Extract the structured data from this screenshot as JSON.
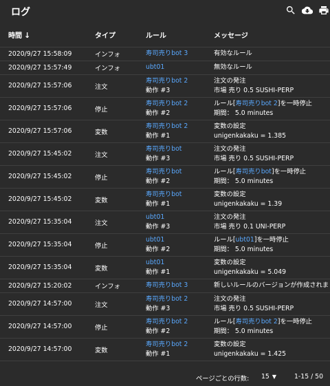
{
  "header": {
    "title": "ログ",
    "icons": [
      "search-icon",
      "download-icon",
      "print-icon"
    ]
  },
  "table": {
    "headers": {
      "time": "時間",
      "sort_arrow": "↓",
      "type": "タイプ",
      "rule": "ルール",
      "message": "メッセージ"
    },
    "rows": [
      {
        "time": "2020/9/27 15:58:09",
        "type": "インフォ",
        "rule": "寿司売りbot 3",
        "action": "",
        "msg1": "有効なルール",
        "msg2": ""
      },
      {
        "time": "2020/9/27 15:57:49",
        "type": "インフォ",
        "rule": "ubt01",
        "action": "",
        "msg1": "無効なルール",
        "msg2": ""
      },
      {
        "time": "2020/9/27 15:57:06",
        "type": "注文",
        "rule": "寿司売りbot 2",
        "action": "動作 #3",
        "msg1": "注文の発注",
        "msg2": "市場 売り 0.5 SUSHI-PERP"
      },
      {
        "time": "2020/9/27 15:57:06",
        "type": "停止",
        "rule": "寿司売りbot 2",
        "action": "動作 #2",
        "msg1_pre": "ルール[",
        "msg1_link": "寿司売りbot 2",
        "msg1_post": "]を一時停止",
        "msg2": "期間： 5.0 minutes"
      },
      {
        "time": "2020/9/27 15:57:06",
        "type": "変数",
        "rule": "寿司売りbot 2",
        "action": "動作 #1",
        "msg1": "変数の設定",
        "msg2": "unigenkakaku = 1.385"
      },
      {
        "time": "2020/9/27 15:45:02",
        "type": "注文",
        "rule": "寿司売りbot",
        "action": "動作 #3",
        "msg1": "注文の発注",
        "msg2": "市場 売り 0.5 SUSHI-PERP"
      },
      {
        "time": "2020/9/27 15:45:02",
        "type": "停止",
        "rule": "寿司売りbot",
        "action": "動作 #2",
        "msg1_pre": "ルール[",
        "msg1_link": "寿司売りbot",
        "msg1_post": "]を一時停止",
        "msg2": "期間： 5.0 minutes"
      },
      {
        "time": "2020/9/27 15:45:02",
        "type": "変数",
        "rule": "寿司売りbot",
        "action": "動作 #1",
        "msg1": "変数の設定",
        "msg2": "unigenkakaku = 1.39"
      },
      {
        "time": "2020/9/27 15:35:04",
        "type": "注文",
        "rule": "ubt01",
        "action": "動作 #3",
        "msg1": "注文の発注",
        "msg2": "市場 売り 0.1 UNI-PERP"
      },
      {
        "time": "2020/9/27 15:35:04",
        "type": "停止",
        "rule": "ubt01",
        "action": "動作 #2",
        "msg1_pre": "ルール[",
        "msg1_link": "ubt01",
        "msg1_post": "]を一時停止",
        "msg2": "期間： 5.0 minutes"
      },
      {
        "time": "2020/9/27 15:35:04",
        "type": "変数",
        "rule": "ubt01",
        "action": "動作 #1",
        "msg1": "変数の設定",
        "msg2": "unigenkakaku = 5.049"
      },
      {
        "time": "2020/9/27 15:20:02",
        "type": "インフォ",
        "rule": "寿司売りbot 3",
        "action": "",
        "msg1": "新しいルールのバージョンが作成されました",
        "msg2": ""
      },
      {
        "time": "2020/9/27 14:57:00",
        "type": "注文",
        "rule": "寿司売りbot 2",
        "action": "動作 #3",
        "msg1": "注文の発注",
        "msg2": "市場 売り 0.5 SUSHI-PERP"
      },
      {
        "time": "2020/9/27 14:57:00",
        "type": "停止",
        "rule": "寿司売りbot 2",
        "action": "動作 #2",
        "msg1_pre": "ルール[",
        "msg1_link": "寿司売りbot 2",
        "msg1_post": "]を一時停止",
        "msg2": "期間： 5.0 minutes"
      },
      {
        "time": "2020/9/27 14:57:00",
        "type": "変数",
        "rule": "寿司売りbot 2",
        "action": "動作 #1",
        "msg1": "変数の設定",
        "msg2": "unigenkakaku = 1.425"
      }
    ]
  },
  "footer": {
    "rows_per_page_label": "ページごとの行数:",
    "rows_per_page": "15",
    "range": "1-15 / 50"
  },
  "colors": {
    "background": "#2b2b2b",
    "link": "#5aa9ff",
    "text": "#ffffff",
    "divider": "#3f3f3f"
  }
}
